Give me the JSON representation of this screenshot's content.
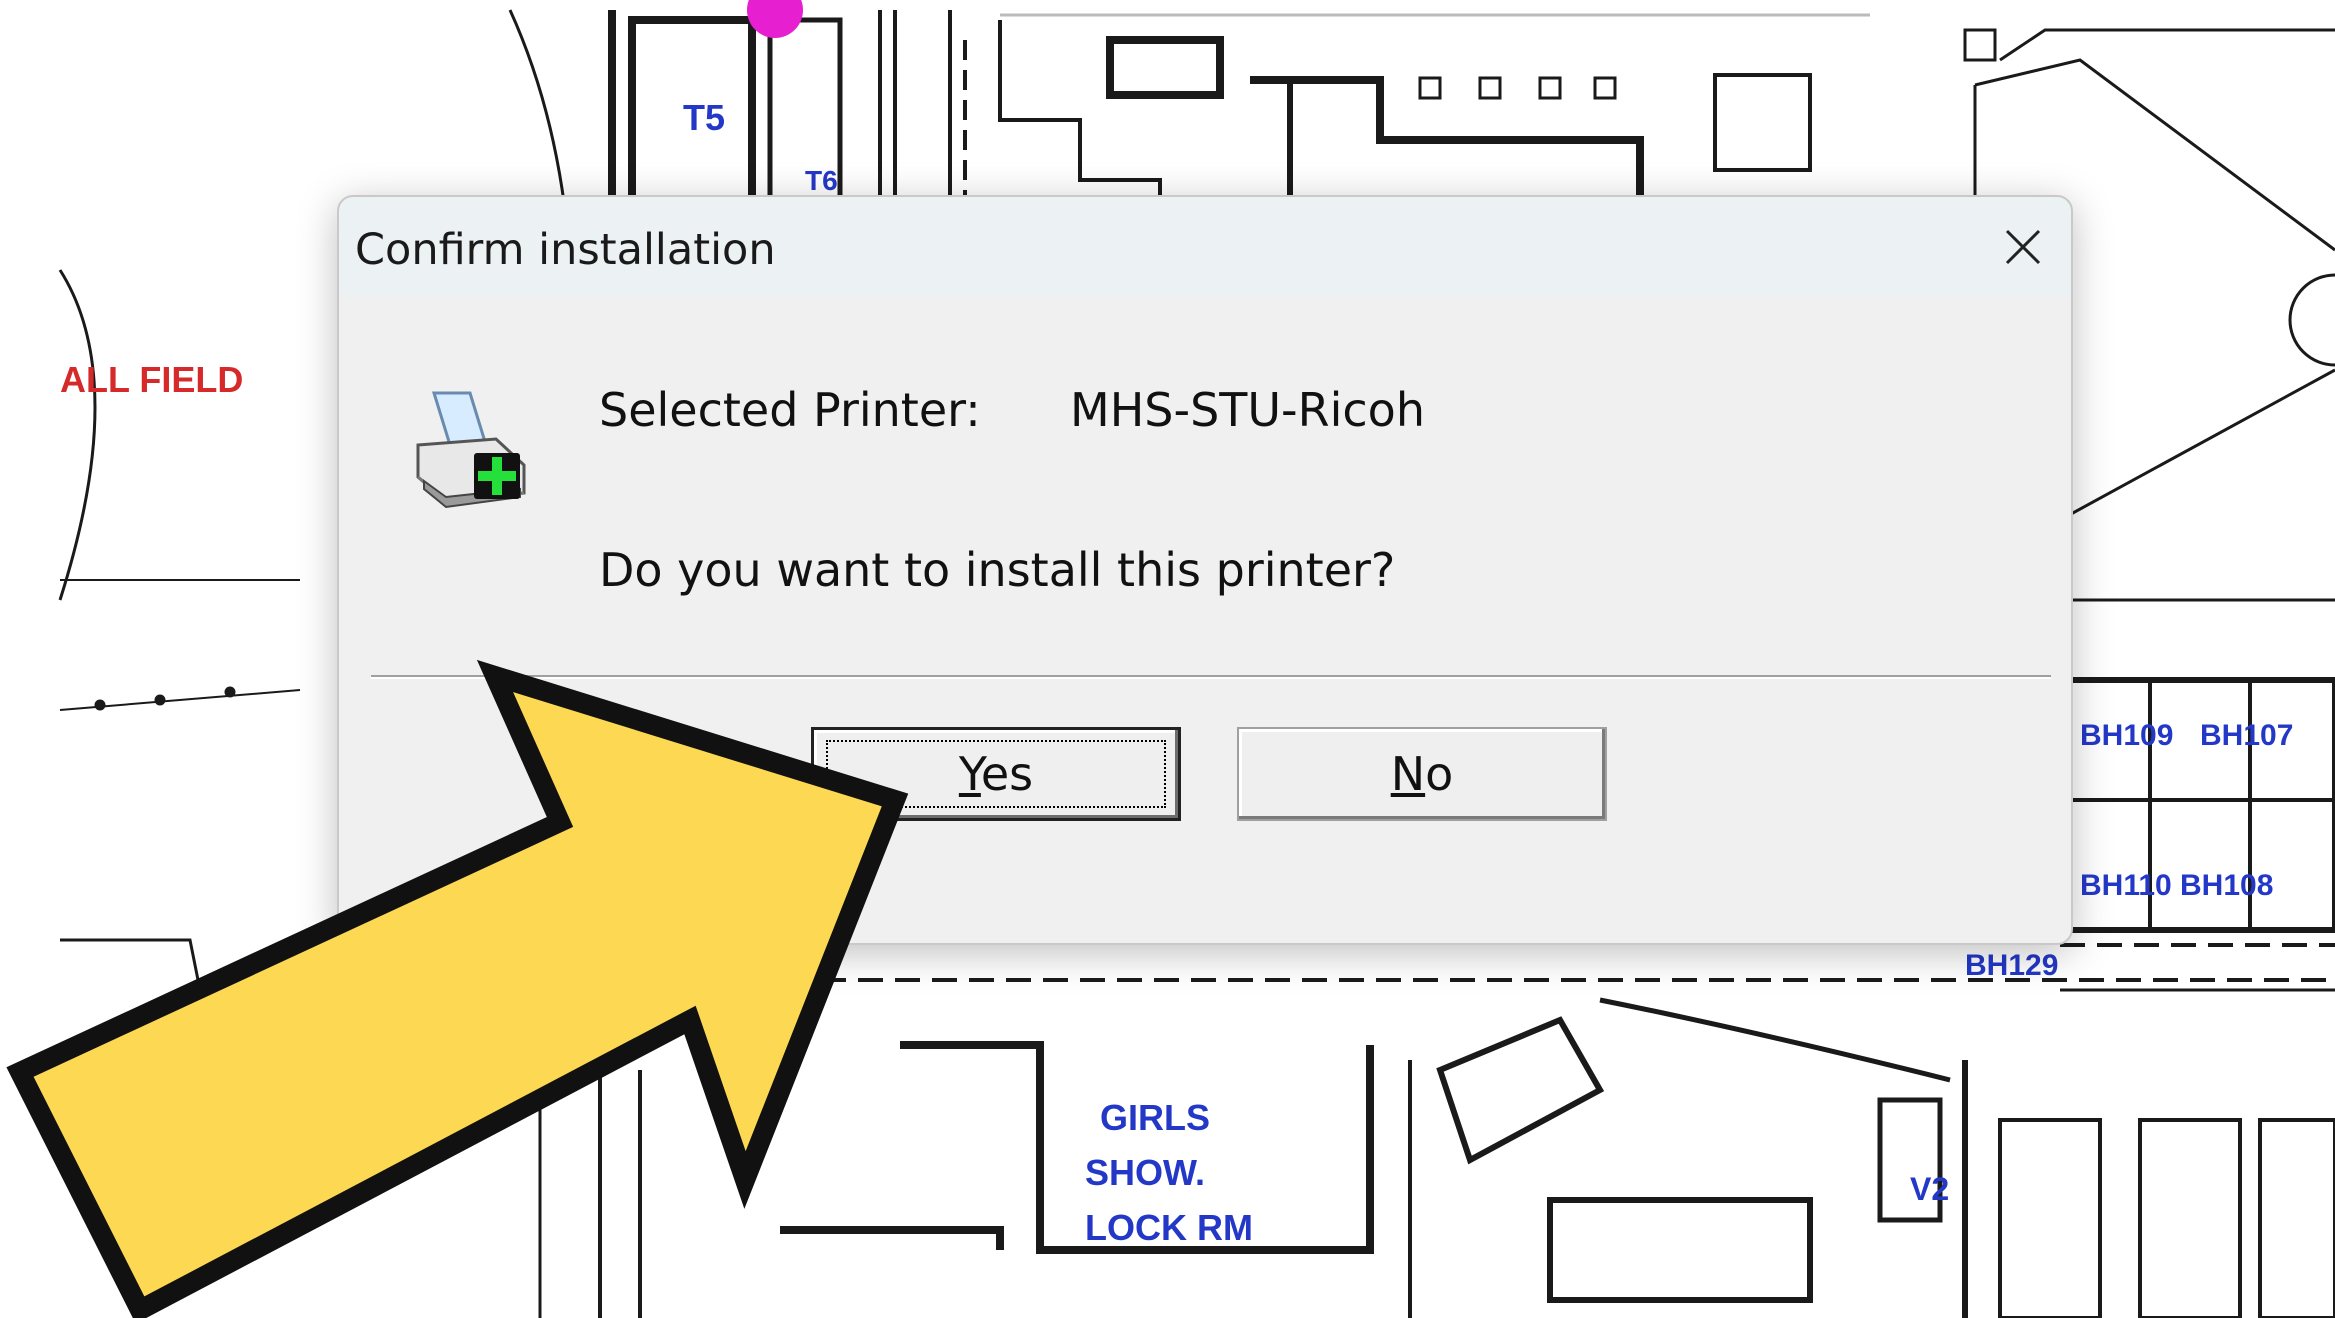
{
  "dialog": {
    "title": "Confirm installation",
    "selected_printer_label": "Selected Printer:",
    "printer_name": "MHS-STU-Ricoh",
    "question": "Do you want to install this printer?",
    "yes": {
      "mnemonic": "Y",
      "rest": "es"
    },
    "no": {
      "mnemonic": "N",
      "rest": "o"
    },
    "icon": "printer-add-icon"
  },
  "background_map": {
    "labels": [
      "T5",
      "T6",
      "ALL FIELD",
      "BH109",
      "BH107",
      "BH110",
      "BH108",
      "BH129",
      "GIRLS",
      "SHOW.",
      "LOCK RM",
      "V2"
    ]
  },
  "overlay": {
    "arrow_color": "#fcd853",
    "arrow_outline": "#111111",
    "icon": "pointer-arrow"
  }
}
